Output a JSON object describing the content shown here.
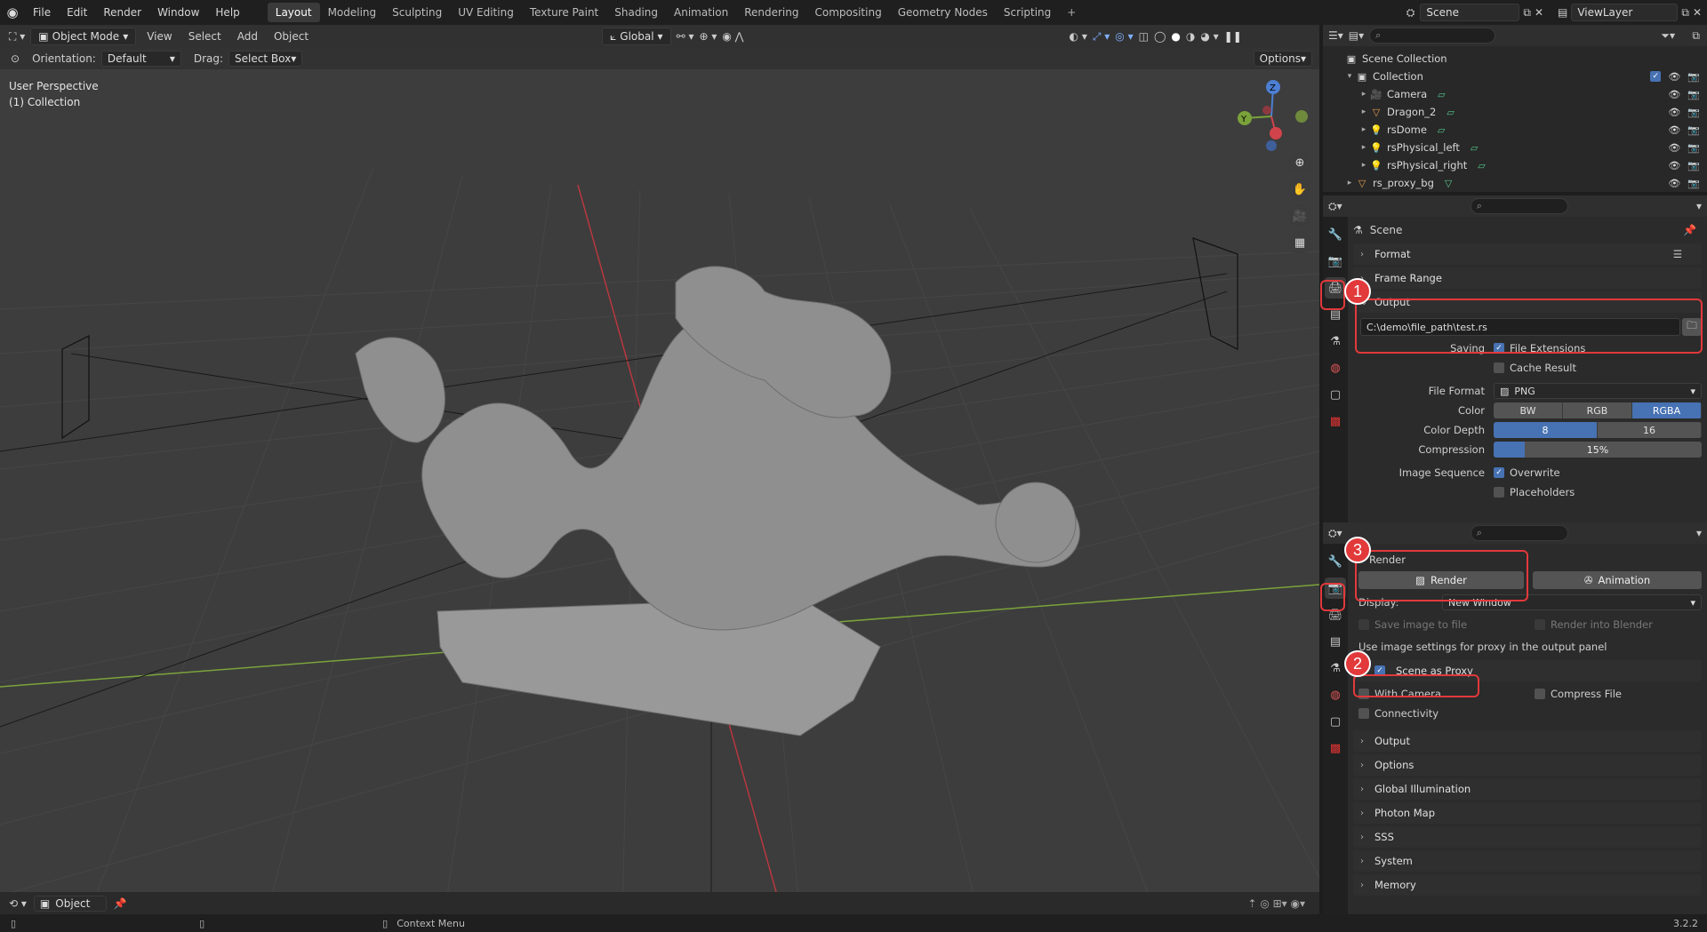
{
  "topbar": {
    "menu": [
      "File",
      "Edit",
      "Render",
      "Window",
      "Help"
    ],
    "workspaces": [
      "Layout",
      "Modeling",
      "Sculpting",
      "UV Editing",
      "Texture Paint",
      "Shading",
      "Animation",
      "Rendering",
      "Compositing",
      "Geometry Nodes",
      "Scripting"
    ],
    "active_workspace": "Layout",
    "plus": "+",
    "scene": "Scene",
    "view_layer": "ViewLayer"
  },
  "viewport": {
    "mode": "Object Mode",
    "menus": [
      "View",
      "Select",
      "Add",
      "Object"
    ],
    "transform": "Global",
    "orientation_label": "Orientation:",
    "orientation_value": "Default",
    "drag_label": "Drag:",
    "drag_value": "Select Box",
    "options_label": "Options",
    "overlay_line1": "User Perspective",
    "overlay_line2": "(1) Collection",
    "gizmo_labels": {
      "z": "Z",
      "y": "Y"
    }
  },
  "bottombar": {
    "mode": "Object"
  },
  "statusbar": {
    "context_menu": "Context Menu",
    "version": "3.2.2"
  },
  "outliner": {
    "title": "Scene Collection",
    "collection": "Collection",
    "items": [
      {
        "name": "Camera",
        "icon": "camera-icon"
      },
      {
        "name": "Dragon_2",
        "icon": "mesh-icon"
      },
      {
        "name": "rsDome",
        "icon": "light-icon"
      },
      {
        "name": "rsPhysical_left",
        "icon": "light-icon"
      },
      {
        "name": "rsPhysical_right",
        "icon": "light-icon"
      }
    ],
    "root_item": "rs_proxy_bg"
  },
  "props_output": {
    "context": "Scene",
    "panels": {
      "format": "Format",
      "frame_range": "Frame Range",
      "output": "Output"
    },
    "file_path": "C:\\demo\\file_path\\test.rs",
    "saving_label": "Saving",
    "file_extensions": "File Extensions",
    "cache_result": "Cache Result",
    "file_format_label": "File Format",
    "file_format": "PNG",
    "color_label": "Color",
    "color_options": [
      "BW",
      "RGB",
      "RGBA"
    ],
    "color_selected": "RGBA",
    "depth_label": "Color Depth",
    "depth_options": [
      "8",
      "16"
    ],
    "depth_selected": "8",
    "compression_label": "Compression",
    "compression": "15%",
    "compression_value": 0.15,
    "image_sequence_label": "Image Sequence",
    "overwrite": "Overwrite",
    "placeholders": "Placeholders"
  },
  "props_render": {
    "render_panel": "Render",
    "render_button": "Render",
    "animation_button": "Animation",
    "display_label": "Display:",
    "display_value": "New Window",
    "save_image": "Save image to file",
    "render_into_blender": "Render into Blender",
    "note": "Use image settings for proxy in the output panel",
    "scene_as_proxy": "Scene as Proxy",
    "with_camera": "With Camera",
    "compress_file": "Compress File",
    "connectivity": "Connectivity",
    "sections": [
      "Output",
      "Options",
      "Global Illumination",
      "Photon Map",
      "SSS",
      "System",
      "Memory"
    ]
  },
  "badges": [
    "1",
    "2",
    "3"
  ],
  "colors": {
    "accent": "#4772b3",
    "highlight": "#e2393b"
  }
}
